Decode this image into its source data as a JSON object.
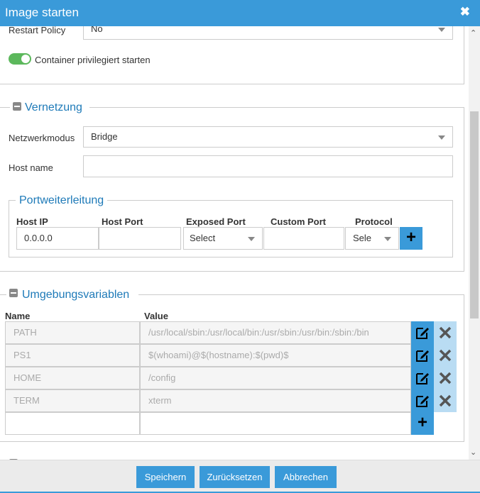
{
  "dialog": {
    "title": "Image starten",
    "close_glyph": "✖"
  },
  "general": {
    "restart_policy_label": "Restart Policy",
    "restart_policy_value": "No",
    "privileged_label": "Container privilegiert starten",
    "privileged_enabled": true
  },
  "network": {
    "legend": "Vernetzung",
    "mode_label": "Netzwerkmodus",
    "mode_value": "Bridge",
    "hostname_label": "Host name",
    "hostname_value": ""
  },
  "ports": {
    "legend": "Portweiterleitung",
    "columns": {
      "host_ip": "Host IP",
      "host_port": "Host Port",
      "exposed_port": "Exposed Port",
      "custom_port": "Custom Port",
      "protocol": "Protocol"
    },
    "row": {
      "host_ip": "0.0.0.0",
      "host_port": "",
      "exposed_port": "Select",
      "custom_port": "",
      "protocol": "Sele"
    }
  },
  "env": {
    "legend": "Umgebungsvariablen",
    "columns": {
      "name": "Name",
      "value": "Value"
    },
    "rows": [
      {
        "name": "PATH",
        "value": "/usr/local/sbin:/usr/local/bin:/usr/sbin:/usr/bin:/sbin:/bin"
      },
      {
        "name": "PS1",
        "value": "$(whoami)@$(hostname):$(pwd)$"
      },
      {
        "name": "HOME",
        "value": "/config"
      },
      {
        "name": "TERM",
        "value": "xterm"
      }
    ]
  },
  "footer": {
    "save": "Speichern",
    "reset": "Zurücksetzen",
    "cancel": "Abbrechen"
  },
  "icons": {
    "close": "close-icon",
    "collapse": "minus-square-icon",
    "add": "plus-icon",
    "edit": "edit-icon",
    "delete": "times-icon",
    "dropdown": "caret-down-icon"
  },
  "colors": {
    "accent": "#3a9ad9",
    "legend": "#1e7ab8",
    "toggle_on": "#5cb85c"
  }
}
